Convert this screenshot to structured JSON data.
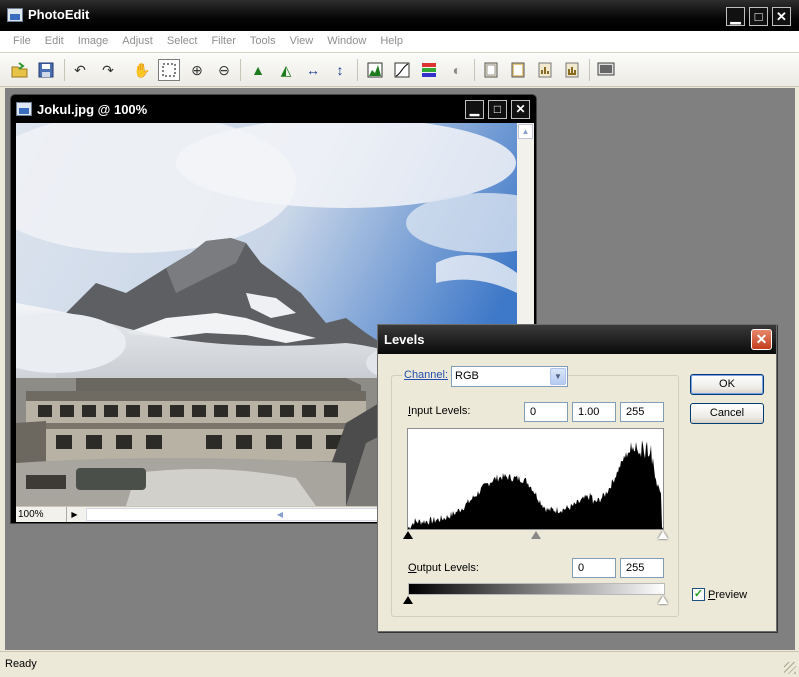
{
  "app": {
    "title": "PhotoEdit",
    "minimize": "▁",
    "maximize": "□",
    "close": "✕"
  },
  "menu": [
    "File",
    "Edit",
    "Image",
    "Adjust",
    "Select",
    "Filter",
    "Tools",
    "View",
    "Window",
    "Help"
  ],
  "toolbar_icons": [
    "open-icon",
    "save-icon",
    "undo-icon",
    "redo-icon",
    "hand-icon",
    "marquee-icon",
    "zoom-in-icon",
    "zoom-out-icon",
    "flip-horizontal-icon",
    "flip-vertical-icon",
    "resize-width-icon",
    "resize-height-icon",
    "levels-icon",
    "curves-icon",
    "color-balance-icon",
    "brightness-icon",
    "frame-icon",
    "border-icon",
    "histogram-icon",
    "chart-icon",
    "fullscreen-icon"
  ],
  "document": {
    "title": "Jokul.jpg @ 100%",
    "zoom": "100%"
  },
  "status": {
    "text": "Ready"
  },
  "levels_dialog": {
    "title": "Levels",
    "channel_label": "Channel:",
    "channel_value": "RGB",
    "input_label": "Input Levels:",
    "input_black": "0",
    "input_gamma": "1.00",
    "input_white": "255",
    "output_label": "Output Levels:",
    "output_black": "0",
    "output_white": "255",
    "ok_label": "OK",
    "cancel_label": "Cancel",
    "preview_label": "Preview",
    "preview_checked": true
  },
  "colors": {
    "titlebar": "#000000",
    "mdi_background": "#808080",
    "dialog_close": "#c23d1c",
    "sky": "#3e78c8"
  }
}
